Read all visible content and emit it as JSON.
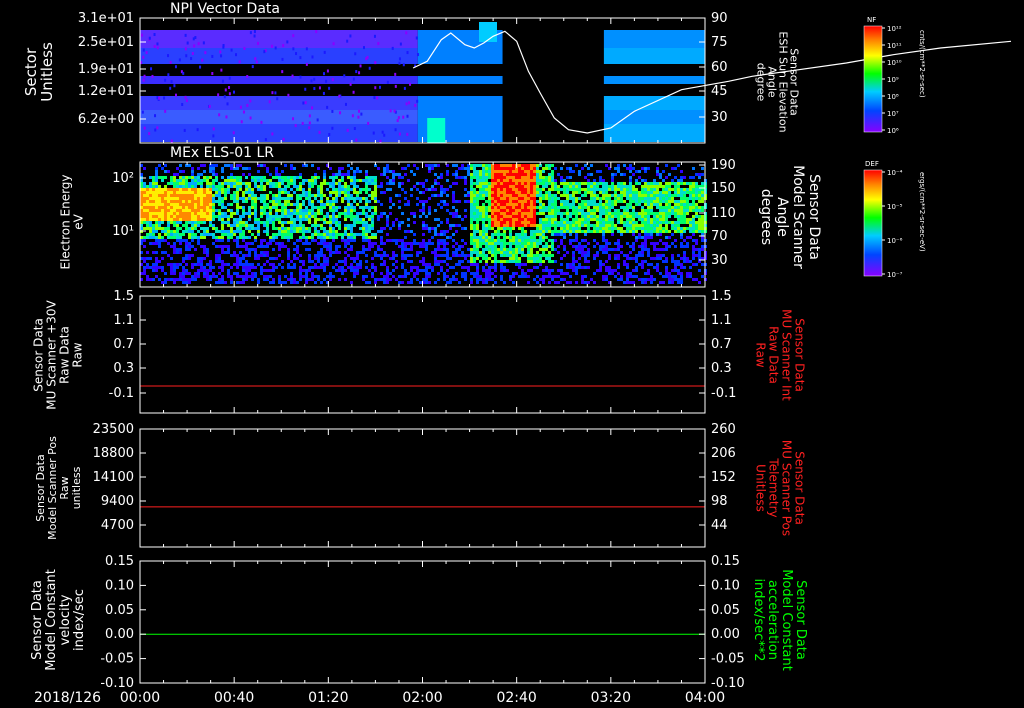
{
  "chart_data": [
    {
      "type": "heatmap",
      "title": "NPI Vector Data",
      "ylabel": "Sector Unitless",
      "y_ticks": [
        "3.1e+01",
        "2.5e+01",
        "1.9e+01",
        "1.2e+01",
        "6.2e+00"
      ],
      "y2label": [
        "Sensor Data",
        "ESH Sun Elevation",
        "Angle",
        "degree"
      ],
      "y2_ticks": [
        "90",
        "75",
        "60",
        "45",
        "30"
      ],
      "y2lim": [
        15,
        90
      ],
      "colorbar": {
        "label": "NF",
        "units": "cnts/(cm**2-sr-sec)",
        "ticks": [
          "10¹²",
          "10¹¹",
          "10¹⁰",
          "10⁹",
          "10⁸",
          "10⁷",
          "10⁶"
        ]
      },
      "series": [
        {
          "name": "ESH Sun Elevation Angle",
          "color": "#ffffff",
          "t_min": [
            0,
            80,
            100,
            110,
            116,
            122,
            128,
            132,
            138,
            142,
            146,
            150,
            155,
            160,
            165,
            170,
            176,
            182,
            190,
            200,
            210,
            230,
            250,
            260,
            275,
            300,
            320,
            340,
            370
          ],
          "values": [
            null,
            null,
            null,
            null,
            60,
            64,
            77,
            81,
            74,
            72,
            75,
            79,
            82,
            76,
            58,
            45,
            30,
            23,
            21,
            24,
            34,
            47,
            52,
            55,
            58,
            63,
            68,
            72,
            76
          ]
        }
      ]
    },
    {
      "type": "heatmap",
      "title": "MEx ELS-01 LR",
      "ylabel": [
        "Electron Energy",
        "eV"
      ],
      "y_ticks": [
        "10²",
        "10¹"
      ],
      "y2label": [
        "Sensor Data",
        "Model Scanner",
        "Angle",
        "degrees"
      ],
      "y2_ticks": [
        "190",
        "150",
        "110",
        "70",
        "30"
      ],
      "colorbar": {
        "label": "DEF",
        "units": "ergs/(cm**2-sr-sec-eV)",
        "ticks": [
          "10⁻⁴",
          "10⁻⁵",
          "10⁻⁶",
          "10⁻⁷"
        ]
      }
    },
    {
      "type": "line",
      "ylabel": [
        "Sensor Data",
        "MU Scanner +30V",
        "Raw Data",
        "Raw"
      ],
      "y_ticks": [
        "1.5",
        "1.1",
        "0.7",
        "0.3",
        "-0.1"
      ],
      "ylim": [
        -0.45,
        1.5
      ],
      "y2label": [
        "Sensor Data",
        "MU Scanner Int",
        "Raw Data",
        "Raw"
      ],
      "y2_ticks": [
        "1.5",
        "1.1",
        "0.7",
        "0.3",
        "-0.1"
      ],
      "series": [
        {
          "color": "#ff2020",
          "values": [
            0.0,
            0.0
          ]
        }
      ]
    },
    {
      "type": "line",
      "ylabel": [
        "Sensor Data",
        "Model Scanner Pos",
        "Raw",
        "unitless"
      ],
      "y_ticks": [
        "23500",
        "18800",
        "14100",
        "9400",
        "4700"
      ],
      "ylim": [
        0,
        23500
      ],
      "y2label": [
        "Sensor Data",
        "MU Scanner Pos",
        "Telemetry",
        "Unitless"
      ],
      "y2_ticks": [
        "260",
        "206",
        "152",
        "98",
        "44"
      ],
      "series": [
        {
          "color": "#ff2020",
          "values": [
            8000,
            8000
          ]
        }
      ]
    },
    {
      "type": "line",
      "ylabel": [
        "Sensor Data",
        "Model Constant",
        "velocity",
        "index/sec"
      ],
      "y_ticks": [
        "0.15",
        "0.10",
        "0.05",
        "0.00",
        "-0.05",
        "-0.10"
      ],
      "ylim": [
        -0.1,
        0.15
      ],
      "y2label": [
        "Sensor Data",
        "Model Constant",
        "acceleration",
        "index/sec**2"
      ],
      "y2_ticks": [
        "0.15",
        "0.10",
        "0.05",
        "0.00",
        "-0.05",
        "-0.10"
      ],
      "series": [
        {
          "color": "#00ff00",
          "values": [
            0.0,
            0.0
          ]
        }
      ]
    }
  ],
  "x_axis": {
    "date": "2018/126",
    "ticks": [
      "00:00",
      "00:40",
      "01:20",
      "02:00",
      "02:40",
      "03:20",
      "04:00"
    ],
    "range_min": [
      0,
      240
    ]
  },
  "colors": {
    "red_label": "#ff2020",
    "green_label": "#00ff00"
  }
}
